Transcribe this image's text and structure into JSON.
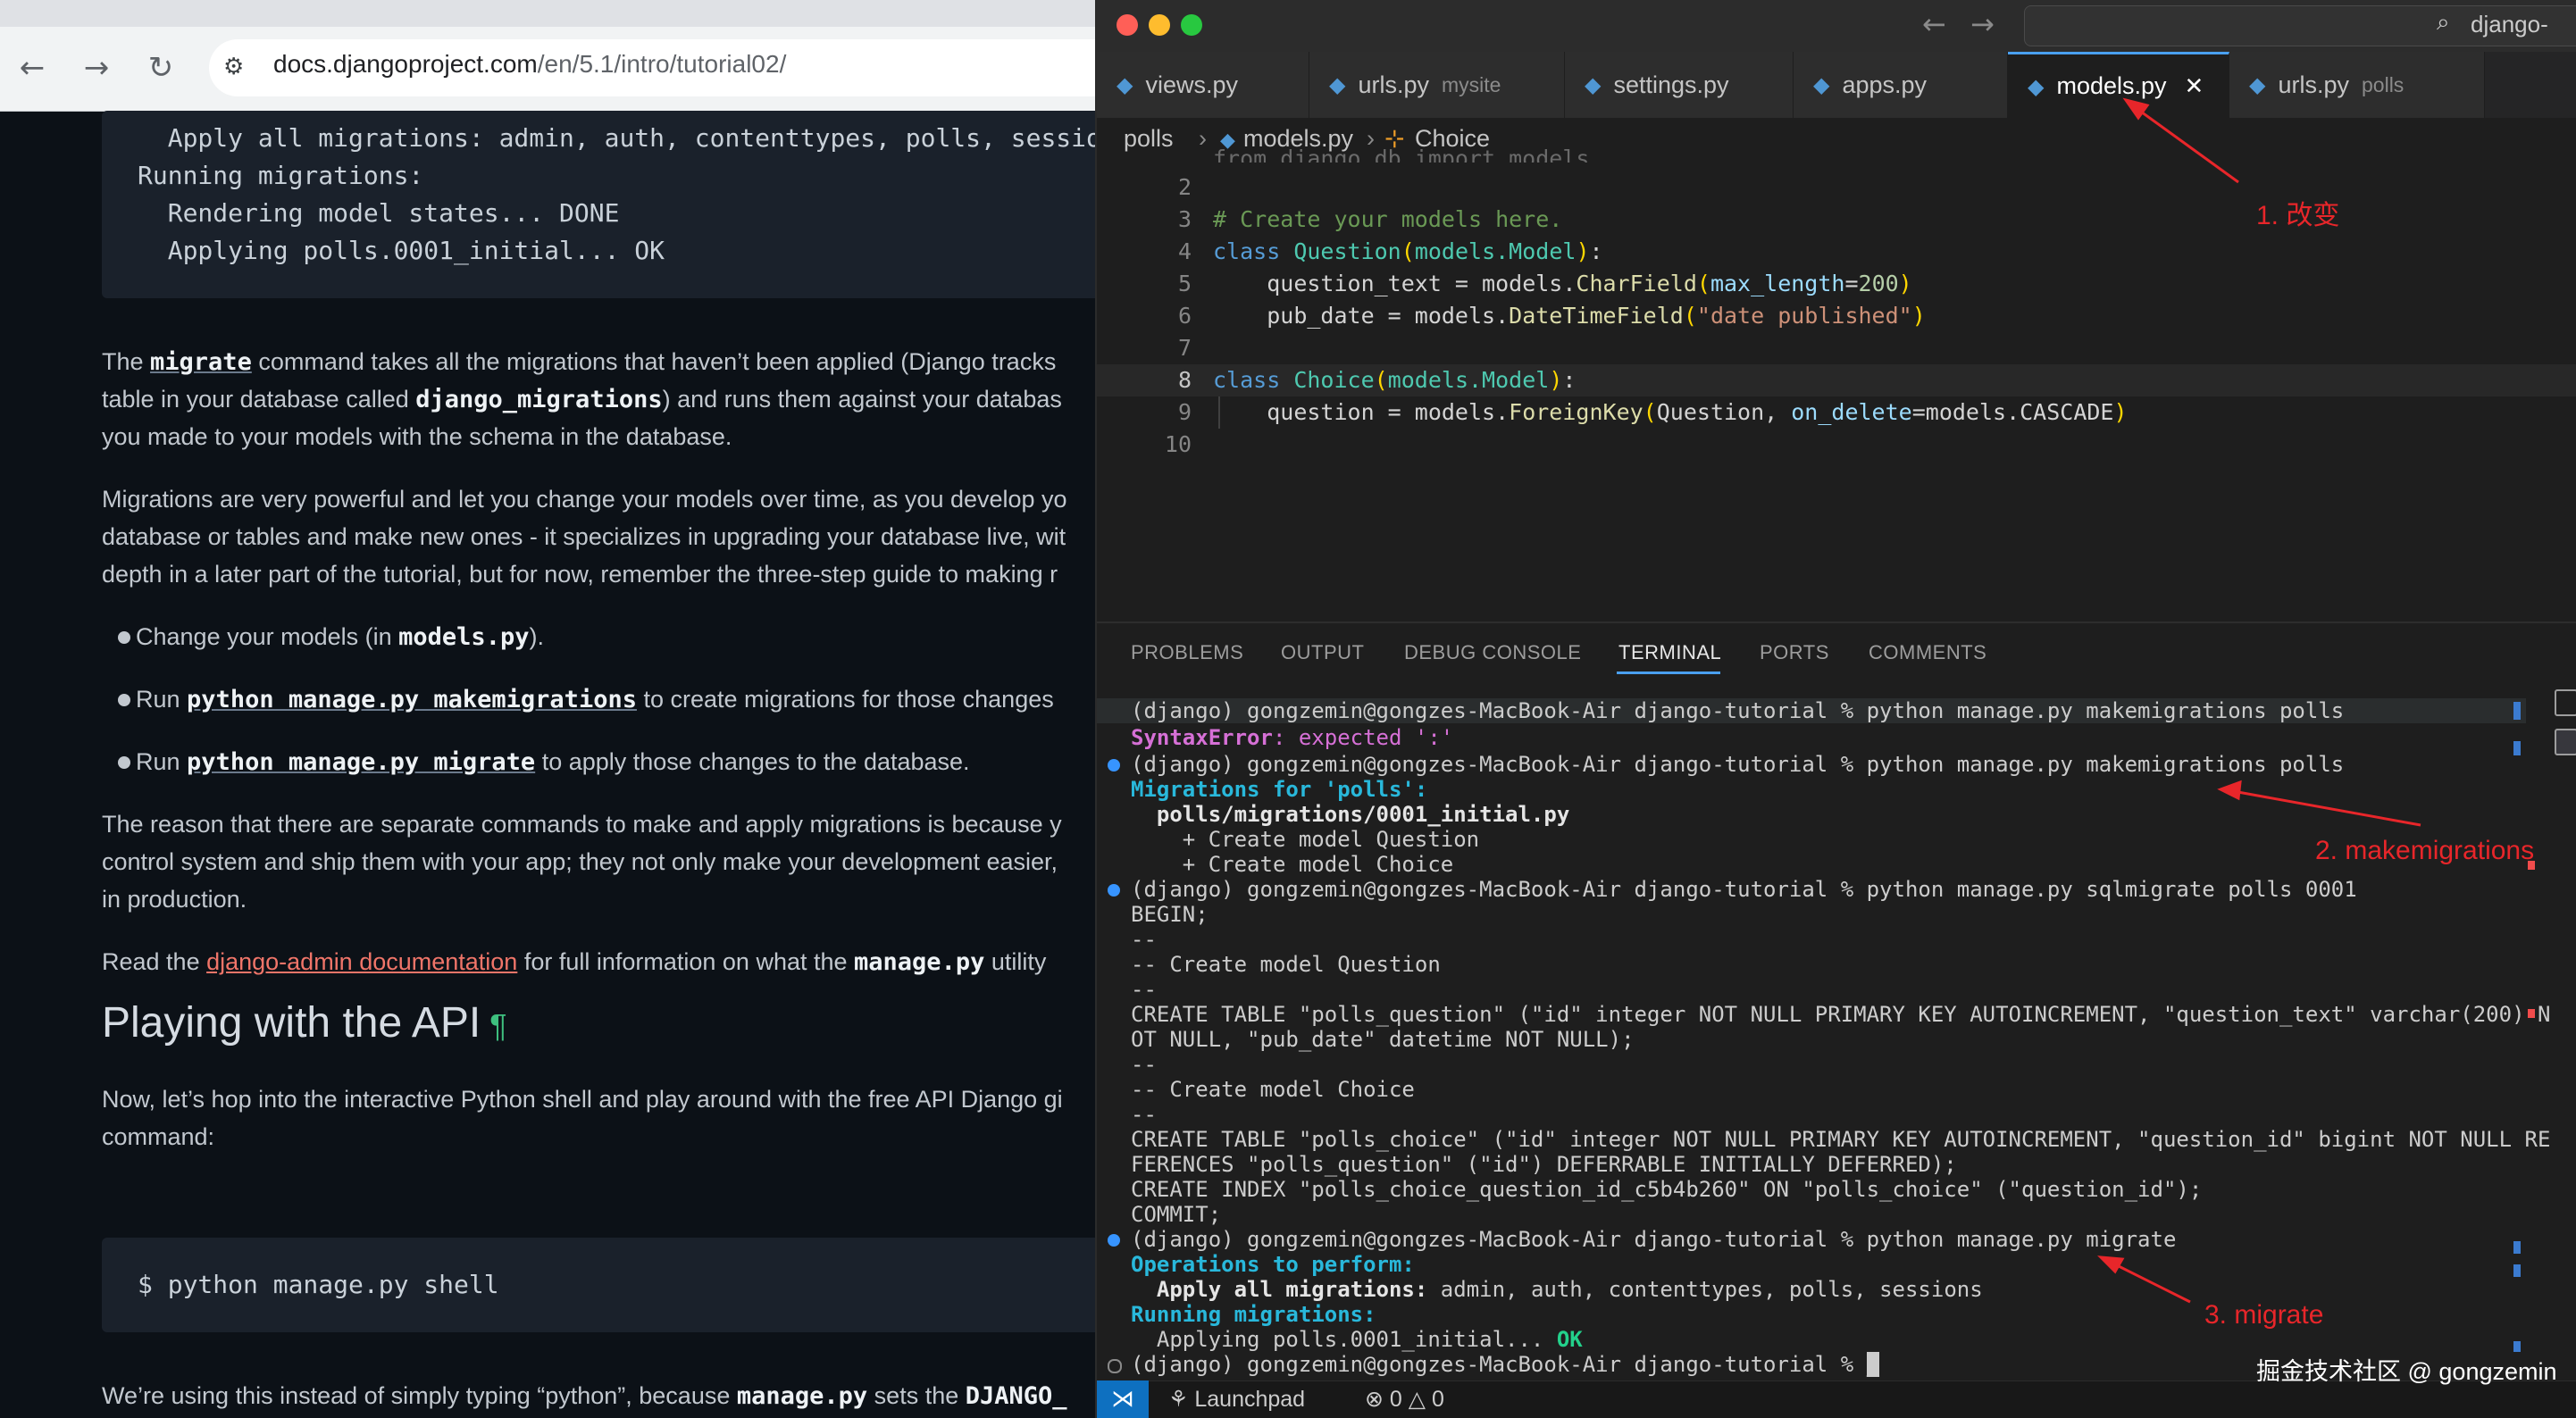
{
  "browser": {
    "url_host": "docs.djangoproject.com",
    "url_path": "/en/5.1/intro/tutorial02/",
    "top_code": [
      "  Apply all migrations: admin, auth, contenttypes, polls, sessio",
      "Running migrations:",
      "  Rendering model states... DONE",
      "  Applying polls.0001_initial... OK"
    ],
    "p1": {
      "a": "The ",
      "cmd": "migrate",
      "b": " command takes all the migrations that haven’t been applied (Django tracks",
      "c": "table in your database called ",
      "tbl": "django_migrations",
      "d": ") and runs them against your databas",
      "e": "you made to your models with the schema in the database."
    },
    "p2": [
      "Migrations are very powerful and let you change your models over time, as you develop yo",
      "database or tables and make new ones - it specializes in upgrading your database live, wit",
      "depth in a later part of the tutorial, but for now, remember the three-step guide to making r"
    ],
    "bullets": [
      {
        "a": "Change your models (in ",
        "code": "models.py",
        "b": ")."
      },
      {
        "a": "Run ",
        "code": "python manage.py makemigrations",
        "b": " to create migrations for those changes"
      },
      {
        "a": "Run ",
        "code": "python manage.py migrate",
        "b": " to apply those changes to the database."
      }
    ],
    "p3": [
      "The reason that there are separate commands to make and apply migrations is because y",
      "control system and ship them with your app; they not only make your development easier,",
      "in production."
    ],
    "p4": {
      "a": "Read the ",
      "link": "django-admin documentation",
      "b": " for full information on what the ",
      "code": "manage.py",
      "c": " utility"
    },
    "heading": "Playing with the API",
    "pilcrow": "¶",
    "p5": [
      "Now, let’s hop into the interactive Python shell and play around with the free API Django gi",
      "command:"
    ],
    "shell_cmd": "$ python manage.py shell",
    "p6": {
      "a": "We’re using this instead of simply typing “python”, because ",
      "code": "manage.py",
      "b": " sets the ",
      "code2": "DJANGO_"
    }
  },
  "vscode": {
    "command_center": "django-",
    "tabs": [
      {
        "label": "views.py",
        "sub": ""
      },
      {
        "label": "urls.py",
        "sub": "mysite"
      },
      {
        "label": "settings.py",
        "sub": ""
      },
      {
        "label": "apps.py",
        "sub": ""
      },
      {
        "label": "models.py",
        "sub": ""
      },
      {
        "label": "urls.py",
        "sub": "polls"
      }
    ],
    "breadcrumb": [
      "polls",
      "models.py",
      "Choice"
    ],
    "line_numbers": [
      "2",
      "3",
      "4",
      "5",
      "6",
      "7",
      "8",
      "9",
      "10"
    ],
    "code": {
      "line1_partial": "from django.db import models",
      "comment": "# Create your models here.",
      "class_kw": "class",
      "question_cls": "Question",
      "choice_cls": "Choice",
      "models_model": "models.Model",
      "qt_a": "question_text = models.",
      "qt_fn": "CharField",
      "qt_param": "max_length",
      "qt_val": "200",
      "pd_a": "pub_date = models.",
      "pd_fn": "DateTimeField",
      "pd_str": "\"date published\"",
      "q_a": "question = models.",
      "q_fn": "ForeignKey",
      "q_b": "Question, ",
      "q_param": "on_delete",
      "q_c": "=models.CASCADE"
    },
    "panel_tabs": [
      "PROBLEMS",
      "OUTPUT",
      "DEBUG CONSOLE",
      "TERMINAL",
      "PORTS",
      "COMMENTS"
    ],
    "terminal": {
      "prompt": "(django) gongzemin@gongzes-MacBook-Air django-tutorial % ",
      "cmd1": "python manage.py makemigrations polls",
      "syntax_err": "SyntaxError",
      "syntax_rest": ": expected ':'",
      "mig_for": "Migrations for 'polls':",
      "mig_file": "  polls/migrations/0001_initial.py",
      "create_q": "    + Create model Question",
      "create_c": "    + Create model Choice",
      "cmd_sql": "python manage.py sqlmigrate polls 0001",
      "begin": "BEGIN;",
      "dash": "--",
      "cm_q": "-- Create model Question",
      "ct1a": "CREATE TABLE \"polls_question\" (\"id\" integer NOT NULL PRIMARY KEY AUTOINCREMENT, \"question_text\" varchar(200) N",
      "ct1b": "OT NULL, \"pub_date\" datetime NOT NULL);",
      "cm_c": "-- Create model Choice",
      "ct2a": "CREATE TABLE \"polls_choice\" (\"id\" integer NOT NULL PRIMARY KEY AUTOINCREMENT, \"question_id\" bigint NOT NULL RE",
      "ct2b": "FERENCES \"polls_question\" (\"id\") DEFERRABLE INITIALLY DEFERRED);",
      "ci": "CREATE INDEX \"polls_choice_question_id_c5b4b260\" ON \"polls_choice\" (\"question_id\");",
      "commit": "COMMIT;",
      "cmd_mig": "python manage.py migrate",
      "ops": "Operations to perform:",
      "apply_label": "  Apply all migrations:",
      "apply_rest": " admin, auth, contenttypes, polls, sessions",
      "running": "Running migrations:",
      "applying": "  Applying polls.0001_initial...",
      "ok": " OK"
    },
    "status": {
      "launchpad": "Launchpad",
      "errors": "0",
      "warnings": "0"
    }
  },
  "annotations": [
    "1. 改变",
    "2. makemigrations",
    "3. migrate"
  ],
  "watermark": "掘金技术社区 @ gongzemin"
}
